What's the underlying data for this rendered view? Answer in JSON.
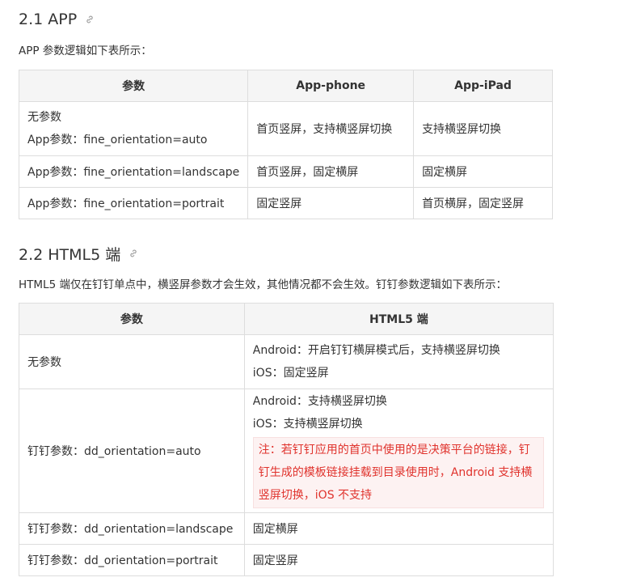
{
  "section_app": {
    "heading": "2.1 APP",
    "intro": "APP 参数逻辑如下表所示：",
    "headers": [
      "参数",
      "App-phone",
      "App-iPad"
    ],
    "rows": [
      {
        "param_line1": "无参数",
        "param_line2": "App参数：fine_orientation=auto",
        "phone": "首页竖屏，支持横竖屏切换",
        "ipad": "支持横竖屏切换"
      },
      {
        "param": "App参数：fine_orientation=landscape",
        "phone": "首页竖屏，固定横屏",
        "ipad": "固定横屏"
      },
      {
        "param": "App参数：fine_orientation=portrait",
        "phone": "固定竖屏",
        "ipad": "首页横屏，固定竖屏"
      }
    ]
  },
  "section_h5": {
    "heading": "2.2 HTML5 端",
    "intro": "HTML5 端仅在钉钉单点中，横竖屏参数才会生效，其他情况都不会生效。钉钉参数逻辑如下表所示：",
    "headers": [
      "参数",
      "HTML5 端"
    ],
    "rows": [
      {
        "param": "无参数",
        "line1": "Android：开启钉钉横屏模式后，支持横竖屏切换",
        "line2": "iOS：固定竖屏"
      },
      {
        "param": "钉钉参数：dd_orientation=auto",
        "line1": "Android：支持横竖屏切换",
        "line2": "iOS：支持横竖屏切换",
        "note": "注：若钉钉应用的首页中使用的是决策平台的链接，钉钉生成的模板链接挂载到目录使用时，Android 支持横竖屏切换，iOS 不支持"
      },
      {
        "param": "钉钉参数：dd_orientation=landscape",
        "value": "固定横屏"
      },
      {
        "param": "钉钉参数：dd_orientation=portrait",
        "value": "固定竖屏"
      }
    ]
  },
  "icons": {
    "anchor": "link-icon"
  },
  "colors": {
    "text": "#333333",
    "header_bg": "#f5f5f5",
    "border": "#dddddd",
    "note_text": "#e0332d",
    "note_bg": "#fdf2f2"
  }
}
